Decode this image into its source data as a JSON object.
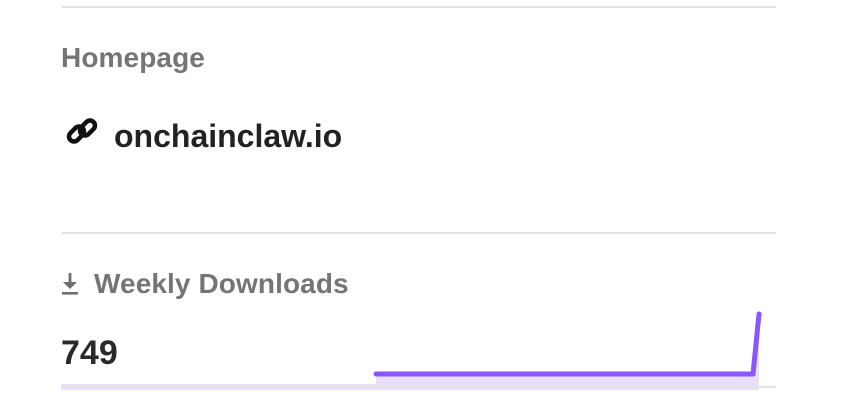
{
  "homepage": {
    "label": "Homepage",
    "url_text": "onchainclaw.io",
    "icon": "link-icon"
  },
  "weekly_downloads": {
    "label": "Weekly Downloads",
    "icon": "download-icon",
    "count": "749",
    "sparkline": {
      "values": [
        0,
        0,
        0,
        0,
        0,
        0,
        0,
        0,
        0,
        0,
        0,
        0,
        749
      ],
      "line_color": "#8956ff",
      "fill_color": "#e6e0fa"
    }
  }
}
